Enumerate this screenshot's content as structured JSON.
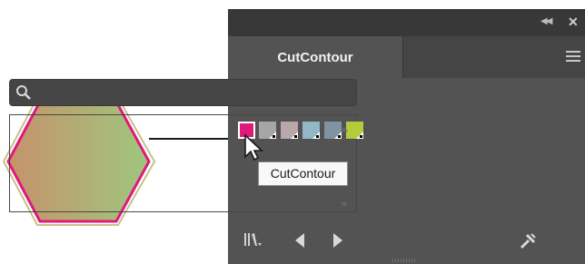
{
  "panel": {
    "tab_label": "CutContour",
    "collapse_icon": "double-chevron-left-icon",
    "close_icon": "close-icon",
    "menu_icon": "hamburger-menu-icon"
  },
  "search": {
    "value": "",
    "placeholder": "",
    "icon": "search-icon"
  },
  "swatches": [
    {
      "name": "CutContour",
      "color": "#e0197b",
      "selected": true
    },
    {
      "name": "",
      "color": "#a6a6a6",
      "selected": false
    },
    {
      "name": "",
      "color": "#b8a8aa",
      "selected": false
    },
    {
      "name": "",
      "color": "#93b7c6",
      "selected": false
    },
    {
      "name": "",
      "color": "#7f94a0",
      "selected": false
    },
    {
      "name": "",
      "color": "#b2cc3c",
      "selected": false
    }
  ],
  "tooltip": {
    "text": "CutContour"
  },
  "bottombar": {
    "icons": [
      "swatch-libraries-icon",
      "previous-arrow-icon",
      "next-arrow-icon",
      "add-to-library-icon"
    ]
  },
  "artwork": {
    "shape": "hexagon",
    "stroke_color": "#e0197b",
    "gradient": [
      "#c7926c",
      "#9ec77d"
    ],
    "connector_color": "#1a1a1a"
  }
}
